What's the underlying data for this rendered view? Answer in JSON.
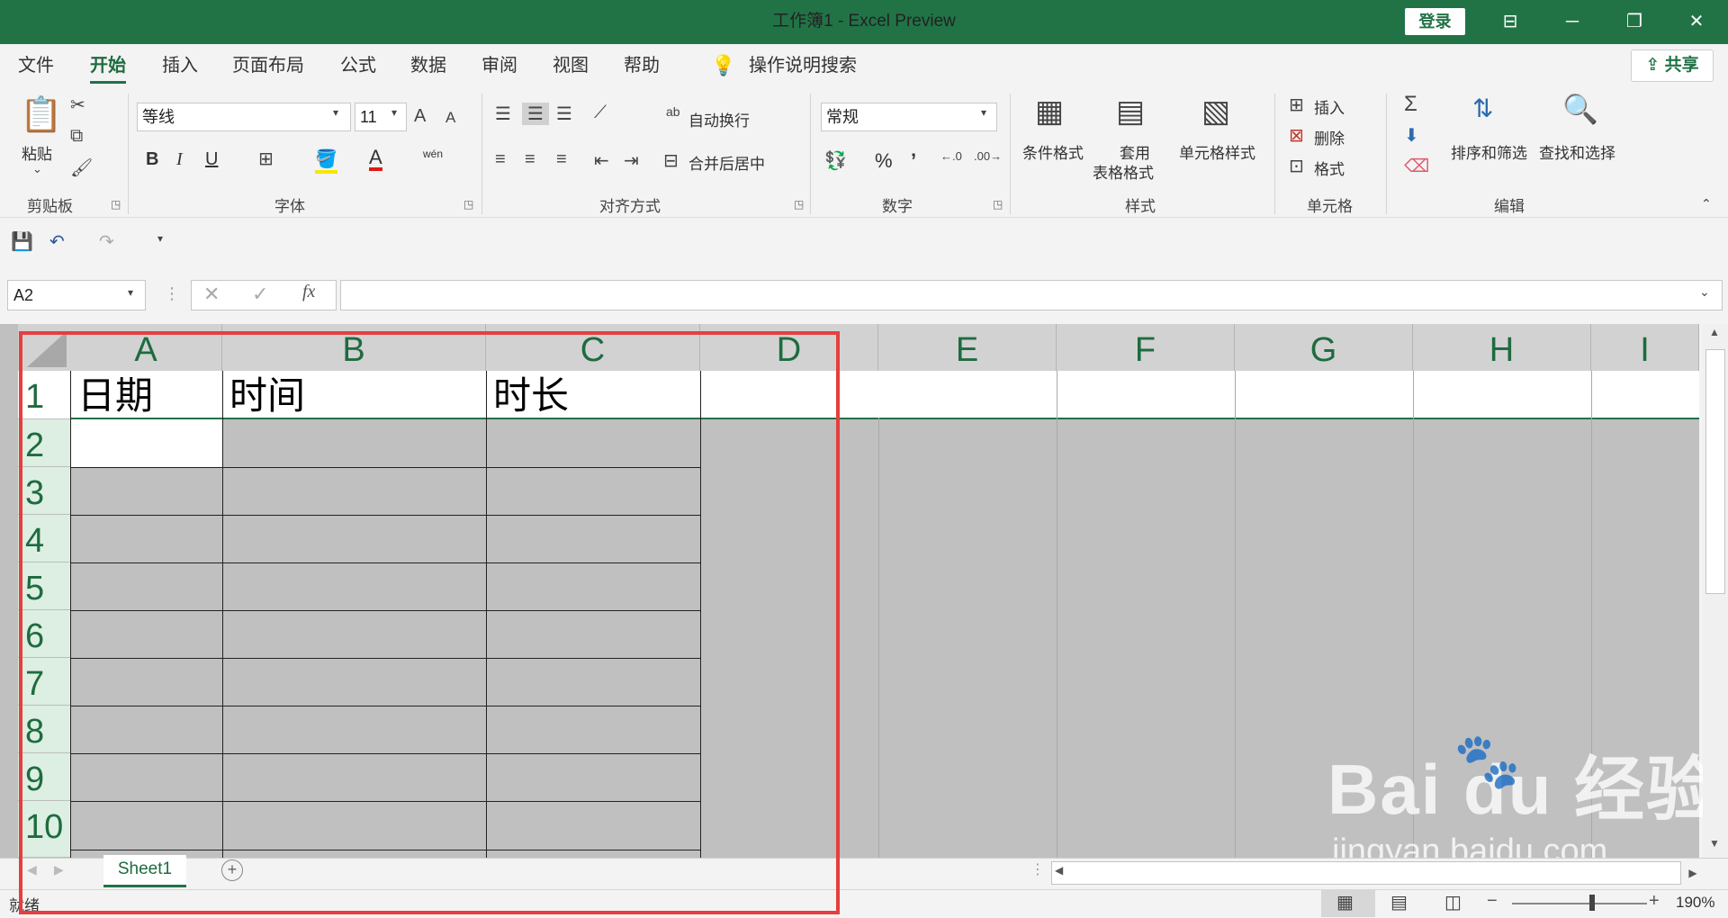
{
  "window": {
    "title": "工作簿1  -  Excel Preview",
    "login": "登录",
    "controls": [
      "⊟",
      "─",
      "❐",
      "✕"
    ]
  },
  "menu": {
    "tabs": [
      "文件",
      "开始",
      "插入",
      "页面布局",
      "公式",
      "数据",
      "审阅",
      "视图",
      "帮助"
    ],
    "active": "开始",
    "search": "操作说明搜索",
    "share": "共享"
  },
  "ribbon": {
    "clipboard": {
      "paste": "粘贴",
      "group": "剪贴板"
    },
    "font": {
      "name": "等线",
      "size": "11",
      "group": "字体",
      "grow": "A",
      "shrink": "A",
      "bold": "B",
      "italic": "I",
      "underline": "U",
      "phonetic": "wén"
    },
    "alignment": {
      "wrap": "自动换行",
      "merge": "合并后居中",
      "group": "对齐方式"
    },
    "number": {
      "format": "常规",
      "percent": "%",
      "comma": "’",
      "group": "数字"
    },
    "styles": {
      "conditional": "条件格式",
      "table_line1": "套用",
      "table_line2": "表格格式",
      "cell_styles": "单元格样式",
      "group": "样式"
    },
    "cells": {
      "insert": "插入",
      "delete": "删除",
      "format": "格式",
      "group": "单元格"
    },
    "editing": {
      "sort": "排序和筛选",
      "find": "查找和选择",
      "group": "编辑"
    }
  },
  "formula_bar": {
    "name_box": "A2",
    "fx": "fx",
    "value": ""
  },
  "sheet": {
    "columns": [
      "A",
      "B",
      "C",
      "D",
      "E",
      "F",
      "G",
      "H",
      "I"
    ],
    "rows": [
      "1",
      "2",
      "3",
      "4",
      "5",
      "6",
      "7",
      "8",
      "9",
      "10"
    ],
    "cells": {
      "A1": "日期",
      "B1": "时间",
      "C1": "时长"
    },
    "selected": "A2"
  },
  "sheet_tabs": [
    "Sheet1"
  ],
  "status": {
    "ready": "就绪",
    "zoom": "190%"
  },
  "watermark": {
    "brand": "Bai du 经验",
    "url": "jingyan.baidu.com"
  },
  "colors": {
    "accent": "#217346",
    "highlight": "#e53f3f"
  }
}
